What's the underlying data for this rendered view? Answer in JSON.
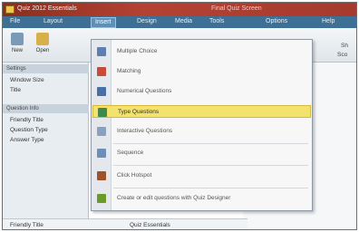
{
  "window": {
    "title": "Quiz 2012 Essentials",
    "title_extra": "Final Quiz Screen"
  },
  "menubar": {
    "items": [
      {
        "label": "File"
      },
      {
        "label": "Layout"
      },
      {
        "label": "Insert"
      },
      {
        "label": "Design"
      },
      {
        "label": "Media"
      },
      {
        "label": "Tools"
      },
      {
        "label": "Options"
      },
      {
        "label": "Help"
      }
    ]
  },
  "toolbar": {
    "buttons": [
      {
        "label": "New",
        "icon": "new-file-icon",
        "color": "#7a9bb8"
      },
      {
        "label": "Open",
        "icon": "open-folder-icon",
        "color": "#d8b04a"
      }
    ]
  },
  "left_panel": {
    "section1": "Settings",
    "props1": [
      "Window Size",
      "Title"
    ],
    "section2": "Question Info",
    "props2": [
      "Friendly Title",
      "Question Type",
      "Answer Type",
      "Friendly Title"
    ]
  },
  "right_area": {
    "label1": "Sh",
    "label2": "Sco"
  },
  "bottom_row": {
    "label": "Friendly Title",
    "value": "Quiz Essentials"
  },
  "dropdown": {
    "items": [
      {
        "label": "Multiple Choice",
        "icon": "multiple-choice-icon",
        "color": "#5d7fb0",
        "highlighted": false
      },
      {
        "label": "Matching",
        "icon": "matching-icon",
        "color": "#c84b3a",
        "highlighted": false
      },
      {
        "label": "Numerical Questions",
        "icon": "numerical-icon",
        "color": "#4a6fa8",
        "highlighted": false
      },
      {
        "label": "Type Questions",
        "icon": "type-questions-icon",
        "color": "#3d8a4a",
        "highlighted": true
      },
      {
        "label": "Interactive Questions",
        "icon": "interactive-icon",
        "color": "#8aa0bc",
        "highlighted": false
      },
      {
        "label": "Sequence",
        "icon": "sequence-icon",
        "color": "#6b8fb8",
        "highlighted": false
      },
      {
        "label": "Click Hotspot",
        "icon": "hotspot-icon",
        "color": "#a0522d",
        "highlighted": false
      },
      {
        "label": "Create or edit questions with Quiz Designer",
        "icon": "designer-icon",
        "color": "#6a9a2a",
        "highlighted": false
      }
    ]
  }
}
